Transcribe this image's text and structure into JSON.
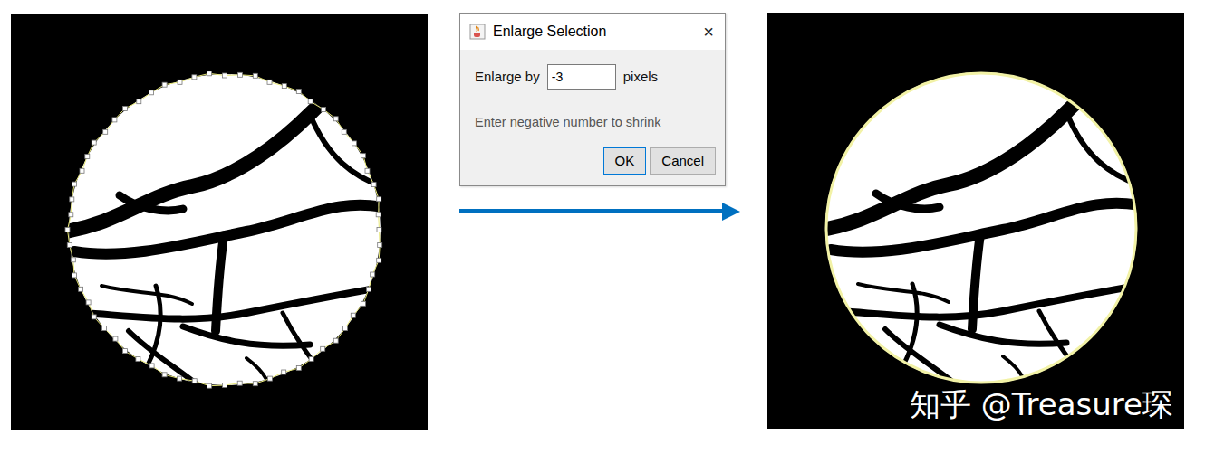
{
  "images": [
    {
      "kind": "polygon"
    },
    {
      "kind": "smooth"
    }
  ],
  "dialog": {
    "title": "Enlarge Selection",
    "close": "×",
    "field_label": "Enlarge by",
    "value": "-3",
    "unit": "pixels",
    "hint": "Enter negative number to shrink",
    "buttons": [
      "OK",
      "Cancel"
    ]
  },
  "watermark": "知乎 @Treasure琛"
}
